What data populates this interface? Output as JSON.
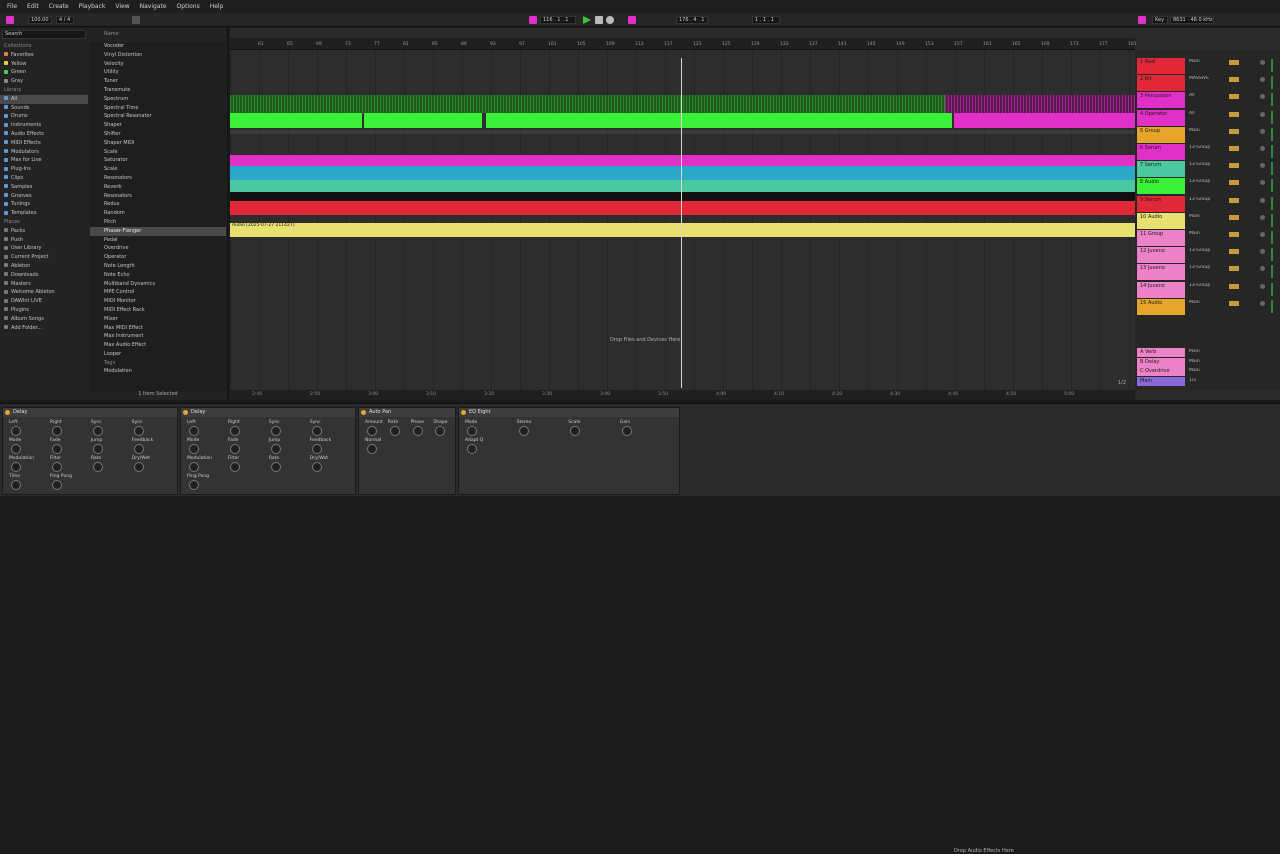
{
  "menu": [
    "File",
    "Edit",
    "Create",
    "Playback",
    "View",
    "Navigate",
    "Options",
    "Help"
  ],
  "transport": {
    "tempo": "100.00",
    "signature": "4 / 4",
    "position": "116 . 1 . 1",
    "loop_start": "176 . 4 . 1",
    "loop_len": "1 . 1 . 1",
    "key": "Key",
    "cpu": "8631 · 48.0 kHz"
  },
  "colors": {
    "green": "#3cf03a",
    "magenta": "#e030c8",
    "cyan": "#2aa8c8",
    "red": "#e02838",
    "yellow": "#e8e070",
    "orange": "#e7a52b",
    "pink": "#ee82c8",
    "teal": "#4cc8a0"
  },
  "browser": {
    "search_placeholder": "Search",
    "collections_title": "Collections",
    "collections": [
      {
        "label": "Favorites",
        "color": "#e8823a"
      },
      {
        "label": "Yellow",
        "color": "#e8d23a"
      },
      {
        "label": "Green",
        "color": "#5ac84a"
      },
      {
        "label": "Gray",
        "color": "#8a8a8a"
      }
    ],
    "library_title": "Library",
    "library": [
      "All",
      "Sounds",
      "Drums",
      "Instruments",
      "Audio Effects",
      "MIDI Effects",
      "Modulators",
      "Max for Live",
      "Plug-Ins",
      "Clips",
      "Samples",
      "Grooves",
      "Tunings",
      "Templates"
    ],
    "places_title": "Places",
    "places": [
      "Packs",
      "Push",
      "User Library",
      "Current Project",
      "Ableton",
      "Downloads",
      "Masters",
      "Welcome Ableton",
      "DAWInt LIVE",
      "Plugins",
      "Album Songs",
      "Add Folder..."
    ],
    "name_header": "Name",
    "items": [
      "Vocoder",
      "Vinyl Distortion",
      "Velocity",
      "Utility",
      "Tuner",
      "Transmute",
      "Spectrum",
      "Spectral Time",
      "Spectral Resonator",
      "Shaper",
      "Shifter",
      "Shaper MIDI",
      "Scale",
      "Saturator",
      "Scale",
      "Resonators",
      "Reverb",
      "Resonators",
      "Redux",
      "Random",
      "Pitch",
      "Phaser-Flanger",
      "Pedal",
      "Overdrive",
      "Operator",
      "Note Length",
      "Note Echo",
      "Multiband Dynamics",
      "MPE Control",
      "MIDI Monitor",
      "MIDI Effect Rack",
      "Mixer",
      "Max MIDI Effect",
      "Max Instrument",
      "Max Audio Effect",
      "Looper"
    ],
    "selected": "Phaser-Flanger",
    "tags": "Tags",
    "modulation": "Modulation",
    "status": "1 Item Selected"
  },
  "arrangement": {
    "ruler": [
      "61",
      "65",
      "69",
      "73",
      "77",
      "81",
      "85",
      "89",
      "93",
      "97",
      "101",
      "105",
      "109",
      "113",
      "117",
      "121",
      "125",
      "129",
      "133",
      "137",
      "141",
      "145",
      "149",
      "153",
      "157",
      "161",
      "165",
      "169",
      "173",
      "177",
      "181"
    ],
    "time": [
      "2:40",
      "2:50",
      "3:00",
      "3:10",
      "3:20",
      "3:30",
      "3:40",
      "3:50",
      "4:00",
      "4:10",
      "4:20",
      "4:30",
      "4:40",
      "4:50",
      "5:00"
    ],
    "audio_clip": "Audio [2025-07-27 211427]",
    "drop_label": "Drop Files and Devices Here",
    "fraction": "1/2"
  },
  "tracks": [
    {
      "name": "1 Reel",
      "color": "#e02838",
      "sub": "Main",
      "k": ""
    },
    {
      "name": "2 Kit",
      "color": "#e02838",
      "sub": "MASSIVE",
      "k": ""
    },
    {
      "name": "3 Percussion",
      "color": "#e030c8",
      "sub": "All",
      "k": ""
    },
    {
      "name": "4 Operator",
      "color": "#e030c8",
      "sub": "All",
      "k": ""
    },
    {
      "name": "5 Group",
      "color": "#e7a52b",
      "sub": "Main",
      "k": ""
    },
    {
      "name": "6 Serum",
      "color": "#e030c8",
      "sub": "13-Group",
      "k": ""
    },
    {
      "name": "7 Serum",
      "color": "#4cc8a0",
      "sub": "13-Group",
      "k": ""
    },
    {
      "name": "8 Audio",
      "color": "#3cf03a",
      "sub": "13-Group",
      "k": ""
    },
    {
      "name": "9 Serum",
      "color": "#e02838",
      "sub": "13-Group",
      "k": ""
    },
    {
      "name": "10 Audio",
      "color": "#e8e070",
      "sub": "Main",
      "k": ""
    },
    {
      "name": "11 Group",
      "color": "#ee82c8",
      "sub": "Main",
      "k": ""
    },
    {
      "name": "12 Juveno",
      "color": "#ee82c8",
      "sub": "13-Group",
      "k": ""
    },
    {
      "name": "13 Juveno",
      "color": "#ee82c8",
      "sub": "13-Group",
      "k": ""
    },
    {
      "name": "14 Juveno",
      "color": "#ee82c8",
      "sub": "13-Group",
      "k": ""
    },
    {
      "name": "15 Audio",
      "color": "#e7a52b",
      "sub": "Main",
      "k": ""
    }
  ],
  "returns": [
    {
      "name": "A Verb",
      "color": "#ee82c8",
      "sub": "Main"
    },
    {
      "name": "B Delay",
      "color": "#ee82c8",
      "sub": "Main"
    },
    {
      "name": "C Overdrive",
      "color": "#ee82c8",
      "sub": "Main"
    },
    {
      "name": "Main",
      "color": "#8a6ad8",
      "sub": "1/2"
    }
  ],
  "devices": [
    {
      "title": "Delay",
      "labels": [
        "Left",
        "Right",
        "Sync",
        "Sync",
        "Mode",
        "Fade",
        "Jump",
        "Feedback",
        "Modulation",
        "Filter",
        "Rate",
        "Dry/Wet",
        "Time",
        "Ping Pong"
      ]
    },
    {
      "title": "Delay",
      "labels": [
        "Left",
        "Right",
        "Sync",
        "Sync",
        "Mode",
        "Fade",
        "Jump",
        "Feedback",
        "Modulation",
        "Filter",
        "Rate",
        "Dry/Wet",
        "Ping Pong"
      ]
    },
    {
      "title": "Auto Pan",
      "labels": [
        "Amount",
        "Rate",
        "Phase",
        "Shape",
        "Normal"
      ]
    },
    {
      "title": "EQ Eight",
      "labels": [
        "Mode",
        "Stereo",
        "Scale",
        "Gain",
        "Adapt Q"
      ]
    }
  ],
  "drop_fx": "Drop Audio Effects Here"
}
